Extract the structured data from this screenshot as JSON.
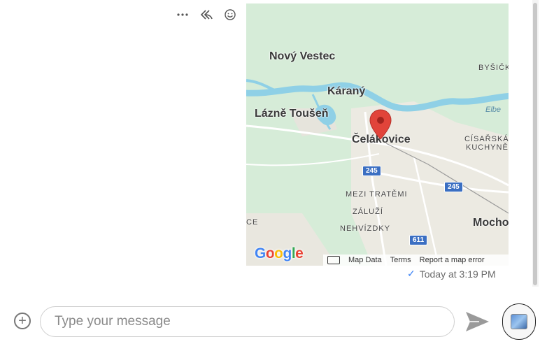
{
  "message_actions": {
    "more_icon": "more-horizontal-icon",
    "reply_all_icon": "reply-all-icon",
    "emoji_icon": "emoji-icon"
  },
  "map": {
    "places": {
      "novy_vestec": "Nový Vestec",
      "karany": "Káraný",
      "lazne_tousen": "Lázně Toušeň",
      "celakovice": "Čelákovice",
      "bysicky": "BYŠIČKY",
      "elbe": "Elbe",
      "cisarska_kuchyne_1": "CÍSAŘSKÁ",
      "cisarska_kuchyne_2": "KUCHYNĚ",
      "mezi_tratemi": "MEZI TRATĚMI",
      "zaluzi": "ZÁLUŽÍ",
      "nehvizdky": "NEHVÍZDKY",
      "mocho": "Mocho",
      "ce": "CE"
    },
    "roads": {
      "r1": "245",
      "r2": "245",
      "r3": "611"
    },
    "logo": "Google",
    "attribution": {
      "map_data": "Map Data",
      "terms": "Terms",
      "report": "Report a map error"
    },
    "colors": {
      "land": "#d6ecd8",
      "water": "#8fd0e6",
      "urban": "#eceae2",
      "pin": "#e1443a"
    }
  },
  "timestamp": "Today at 3:19 PM",
  "composer": {
    "placeholder": "Type your message",
    "value": ""
  }
}
